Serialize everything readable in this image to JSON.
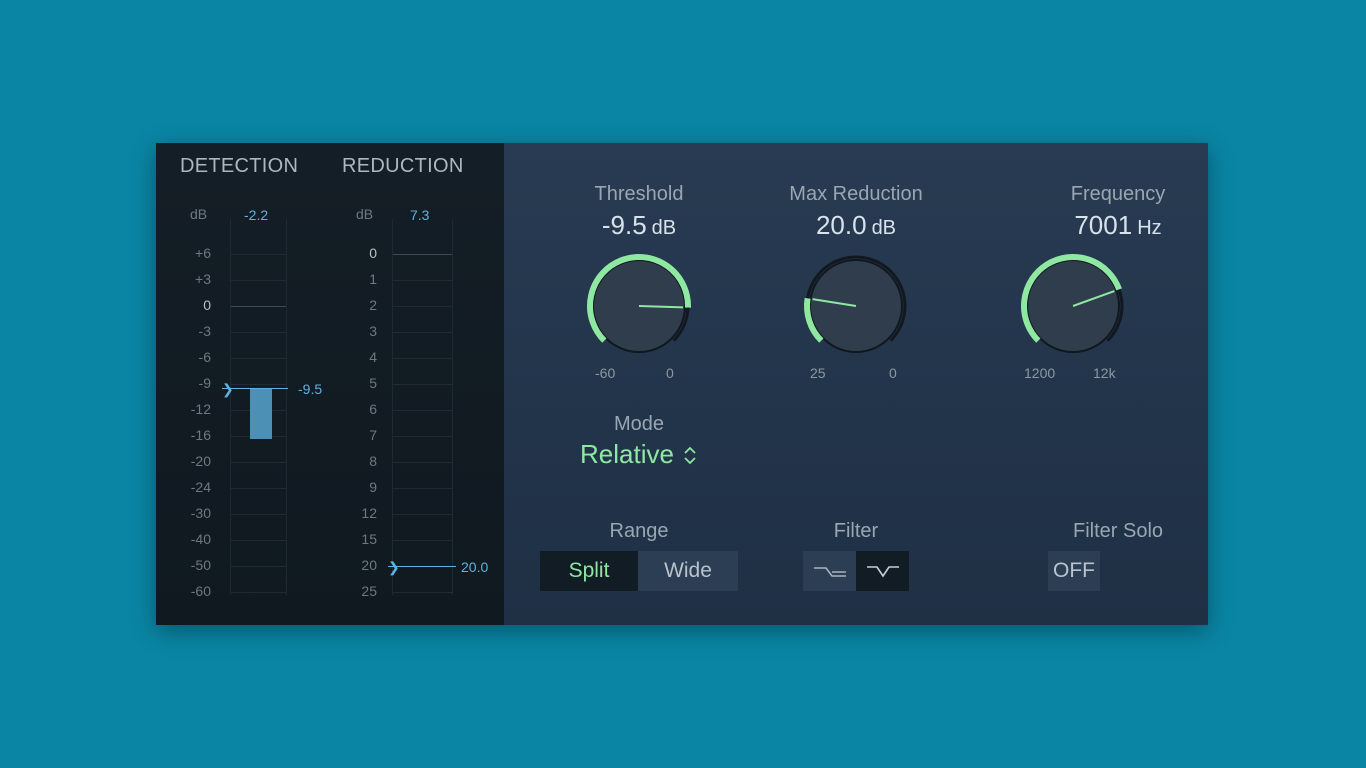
{
  "detection": {
    "title": "DETECTION",
    "db_label": "dB",
    "readout": "-2.2",
    "scale": [
      "+6",
      "+3",
      "0",
      "-3",
      "-6",
      "-9",
      "-12",
      "-16",
      "-20",
      "-24",
      "-30",
      "-40",
      "-50",
      "-60"
    ],
    "threshold_marker": "-9.5"
  },
  "reduction": {
    "title": "REDUCTION",
    "db_label": "dB",
    "readout": "7.3",
    "scale": [
      "0",
      "1",
      "2",
      "3",
      "4",
      "5",
      "6",
      "7",
      "8",
      "9",
      "12",
      "15",
      "20",
      "25"
    ],
    "max_marker": "20.0"
  },
  "knobs": {
    "threshold": {
      "title": "Threshold",
      "value": "-9.5",
      "unit": "dB",
      "min_label": "-60",
      "max_label": "0",
      "fraction": 0.84
    },
    "max_reduction": {
      "title": "Max Reduction",
      "value": "20.0",
      "unit": "dB",
      "min_label": "25",
      "max_label": "0",
      "fraction": 0.2
    },
    "frequency": {
      "title": "Frequency",
      "value": "7001",
      "unit": "Hz",
      "min_label": "1200",
      "max_label": "12k",
      "fraction": 0.76
    }
  },
  "mode": {
    "title": "Mode",
    "value": "Relative",
    "arrow": "⌃⌄"
  },
  "range": {
    "title": "Range",
    "options": [
      "Split",
      "Wide"
    ],
    "selected": "Split"
  },
  "filter": {
    "title": "Filter",
    "selected": "band"
  },
  "filter_solo": {
    "title": "Filter Solo",
    "value": "OFF"
  },
  "colors": {
    "accent": "#8fe8a2",
    "meter": "#5fb2e0",
    "background": "#0a85a4",
    "panel": "#263a50"
  }
}
